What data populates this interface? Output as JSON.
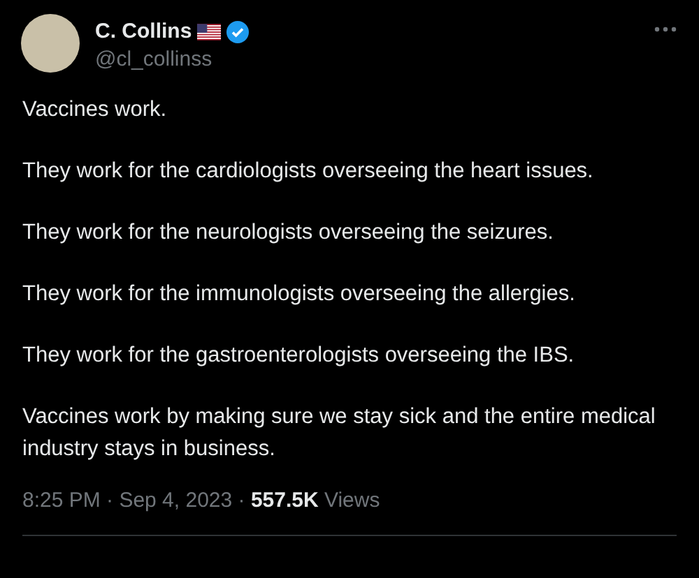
{
  "author": {
    "name": "C. Collins",
    "handle": "@cl_collinss",
    "verified": true
  },
  "paragraphs": [
    "Vaccines work.",
    "They work for the cardiologists overseeing the heart issues.",
    "They work for the neurologists overseeing the seizures.",
    "They work for the immunologists overseeing the allergies.",
    "They work for the gastroenterologists overseeing the IBS.",
    "Vaccines work by making sure we stay sick and the entire medical industry stays in business."
  ],
  "meta": "8:25 PM · Sep 4, 2023 · **557.5K** Views"
}
